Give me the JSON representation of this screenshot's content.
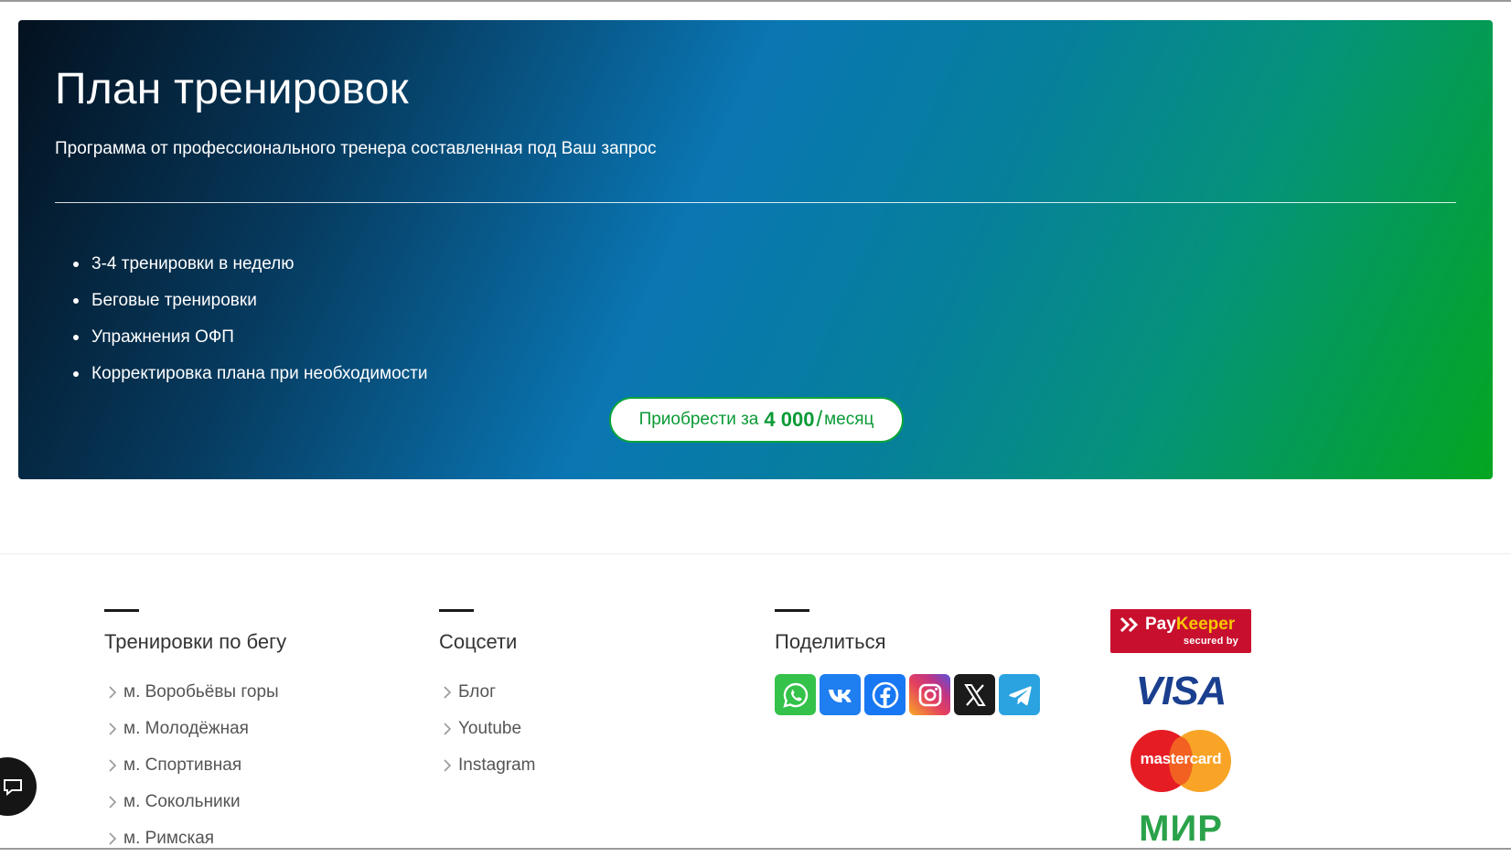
{
  "hero": {
    "title": "План тренировок",
    "subtitle": "Программа от профессионального тренера составленная под Ваш запрос",
    "features": [
      "3-4 тренировки в неделю",
      "Беговые тренировки",
      "Упражнения ОФП",
      "Корректировка плана при необходимости"
    ],
    "buy_button": {
      "prefix": "Приобрести за",
      "price": "4 000",
      "slash": "/",
      "period": "месяц"
    },
    "accent_color": "#0a9a36"
  },
  "footer": {
    "running": {
      "title": "Тренировки по бегу",
      "links": [
        "м. Воробьёвы горы",
        "м. Молодёжная",
        "м. Спортивная",
        "м. Сокольники",
        "м. Римская"
      ]
    },
    "socials": {
      "title": "Соцсети",
      "links": [
        "Блог",
        "Youtube",
        "Instagram"
      ]
    },
    "share": {
      "title": "Поделиться",
      "icons": [
        "whatsapp-icon",
        "vk-icon",
        "facebook-icon",
        "instagram-icon",
        "x-icon",
        "telegram-icon"
      ]
    },
    "payments": {
      "paykeeper_brand_a": "Pay",
      "paykeeper_brand_b": "Keeper",
      "paykeeper_secured": "secured by",
      "visa": "VISA",
      "mastercard": "mastercard",
      "mir": "МИР"
    }
  }
}
